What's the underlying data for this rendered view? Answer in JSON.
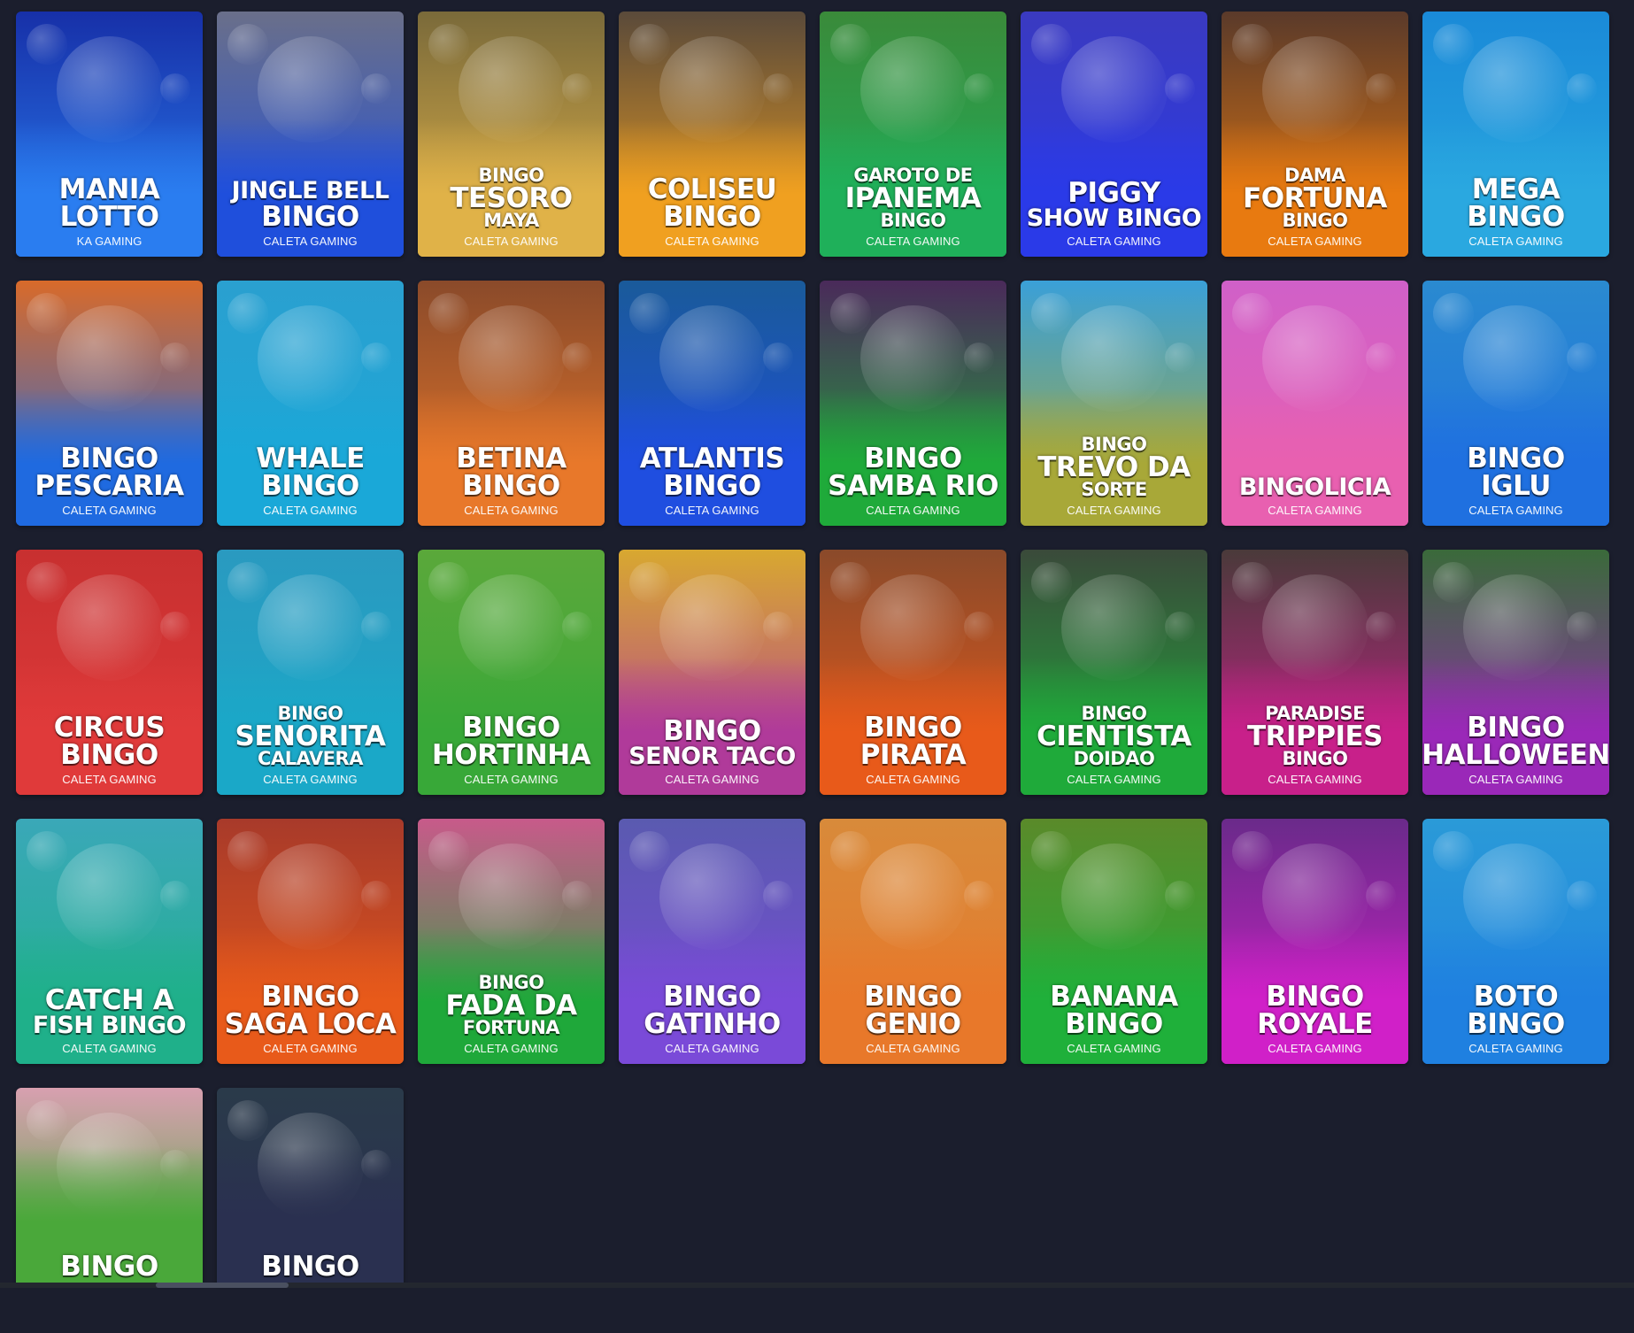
{
  "colors": {
    "page_background": "#1b1e2d",
    "title_text": "#ffffff"
  },
  "games": [
    {
      "title_lines": [
        "MANIA",
        "LOTTO"
      ],
      "provider": "KA GAMING",
      "theme": [
        "#1730a8",
        "#2a7df0"
      ],
      "icon": "lottery-ball-icon"
    },
    {
      "title_lines": [
        "JINGLE BELL",
        "BINGO"
      ],
      "provider": "CALETA GAMING",
      "theme": [
        "#6a6f8a",
        "#1f4fdc"
      ],
      "icon": "santa-icon"
    },
    {
      "title_lines": [
        "BINGO",
        "TESORO",
        "MAYA"
      ],
      "provider": "CALETA GAMING",
      "theme": [
        "#7a6a3a",
        "#e0b248"
      ],
      "icon": "maya-warrior-icon"
    },
    {
      "title_lines": [
        "COLISEU",
        "BINGO"
      ],
      "provider": "CALETA GAMING",
      "theme": [
        "#5a4a3a",
        "#f0a020"
      ],
      "icon": "gladiator-icon"
    },
    {
      "title_lines": [
        "GAROTO DE",
        "IPANEMA",
        "BINGO"
      ],
      "provider": "CALETA GAMING",
      "theme": [
        "#3a8a3a",
        "#1fb05a"
      ],
      "icon": "sailor-icon"
    },
    {
      "title_lines": [
        "PIGGY",
        "SHOW BINGO"
      ],
      "provider": "CALETA GAMING",
      "theme": [
        "#3a3ac0",
        "#2a3ae8"
      ],
      "icon": "pig-icon"
    },
    {
      "title_lines": [
        "DAMA",
        "FORTUNA",
        "BINGO"
      ],
      "provider": "CALETA GAMING",
      "theme": [
        "#5a3a2a",
        "#e87a10"
      ],
      "icon": "fortune-teller-icon"
    },
    {
      "title_lines": [
        "MEGA",
        "BINGO"
      ],
      "provider": "CALETA GAMING",
      "theme": [
        "#1a8ad8",
        "#2aa8e0"
      ],
      "icon": "bingo-ball-icon"
    },
    {
      "title_lines": [
        "BINGO",
        "PESCARIA"
      ],
      "provider": "CALETA GAMING",
      "theme": [
        "#d86a2a",
        "#1f6ae0"
      ],
      "icon": "fisherman-icon"
    },
    {
      "title_lines": [
        "WHALE",
        "BINGO"
      ],
      "provider": "CALETA GAMING",
      "theme": [
        "#2aa0d0",
        "#1aa8d8"
      ],
      "icon": "whale-icon"
    },
    {
      "title_lines": [
        "BETINA",
        "BINGO"
      ],
      "provider": "CALETA GAMING",
      "theme": [
        "#8a4a2a",
        "#e8782a"
      ],
      "icon": "woman-icon"
    },
    {
      "title_lines": [
        "ATLANTIS",
        "BINGO"
      ],
      "provider": "CALETA GAMING",
      "theme": [
        "#1a5a9a",
        "#1f4ee0"
      ],
      "icon": "poseidon-icon"
    },
    {
      "title_lines": [
        "BINGO",
        "SAMBA RIO"
      ],
      "provider": "CALETA GAMING",
      "theme": [
        "#4a2a5a",
        "#1faa3a"
      ],
      "icon": "samba-dancer-icon"
    },
    {
      "title_lines": [
        "BINGO",
        "TREVO DA",
        "SORTE"
      ],
      "provider": "CALETA GAMING",
      "theme": [
        "#3aa0d8",
        "#a8a838"
      ],
      "icon": "leprechaun-icon"
    },
    {
      "title_lines": [
        "BINGOLICIA"
      ],
      "provider": "CALETA GAMING",
      "theme": [
        "#d060c8",
        "#e860b0"
      ],
      "icon": "chef-icon"
    },
    {
      "title_lines": [
        "BINGO",
        "IGLU"
      ],
      "provider": "CALETA GAMING",
      "theme": [
        "#2a8ad0",
        "#1f70e0"
      ],
      "icon": "polar-bear-icon"
    },
    {
      "title_lines": [
        "CIRCUS",
        "BINGO"
      ],
      "provider": "CALETA GAMING",
      "theme": [
        "#c83030",
        "#e03a3a"
      ],
      "icon": "seal-icon"
    },
    {
      "title_lines": [
        "BINGO",
        "SENORITA",
        "CALAVERA"
      ],
      "provider": "CALETA GAMING",
      "theme": [
        "#2a9ac0",
        "#1aa8c8"
      ],
      "icon": "skeleton-icon"
    },
    {
      "title_lines": [
        "BINGO",
        "HORTINHA"
      ],
      "provider": "CALETA GAMING",
      "theme": [
        "#5aa83a",
        "#38a838"
      ],
      "icon": "carrot-icon"
    },
    {
      "title_lines": [
        "BINGO",
        "SENOR TACO"
      ],
      "provider": "CALETA GAMING",
      "theme": [
        "#d8a830",
        "#b03a9a"
      ],
      "icon": "sombrero-icon"
    },
    {
      "title_lines": [
        "BINGO",
        "PIRATA"
      ],
      "provider": "CALETA GAMING",
      "theme": [
        "#8a4a2a",
        "#e85a1a"
      ],
      "icon": "pirate-icon"
    },
    {
      "title_lines": [
        "BINGO",
        "CIENTISTA",
        "DOIDAO"
      ],
      "provider": "CALETA GAMING",
      "theme": [
        "#3a4a3a",
        "#1faa3a"
      ],
      "icon": "scientist-icon"
    },
    {
      "title_lines": [
        "PARADISE",
        "TRIPPIES",
        "BINGO"
      ],
      "provider": "CALETA GAMING",
      "theme": [
        "#4a3a3a",
        "#c8208a"
      ],
      "icon": "monkey-icon"
    },
    {
      "title_lines": [
        "BINGO",
        "HALLOWEEN"
      ],
      "provider": "CALETA GAMING",
      "theme": [
        "#3a6a3a",
        "#9a28b8"
      ],
      "icon": "witch-cauldron-icon"
    },
    {
      "title_lines": [
        "CATCH A",
        "FISH BINGO"
      ],
      "provider": "CALETA GAMING",
      "theme": [
        "#3aa8b8",
        "#1fb08a"
      ],
      "icon": "fish-icon"
    },
    {
      "title_lines": [
        "BINGO",
        "SAGA LOCA"
      ],
      "provider": "CALETA GAMING",
      "theme": [
        "#a83a2a",
        "#e85a1a"
      ],
      "icon": "bandit-icon"
    },
    {
      "title_lines": [
        "BINGO",
        "FADA DA",
        "FORTUNA"
      ],
      "provider": "CALETA GAMING",
      "theme": [
        "#c85a8a",
        "#1fa83a"
      ],
      "icon": "fairy-icon"
    },
    {
      "title_lines": [
        "BINGO",
        "GATINHO"
      ],
      "provider": "CALETA GAMING",
      "theme": [
        "#5a5ab0",
        "#7a4ad8"
      ],
      "icon": "cat-icon"
    },
    {
      "title_lines": [
        "BINGO",
        "GENIO"
      ],
      "provider": "CALETA GAMING",
      "theme": [
        "#d88a3a",
        "#e8782a"
      ],
      "icon": "genie-icon"
    },
    {
      "title_lines": [
        "BANANA",
        "BINGO"
      ],
      "provider": "CALETA GAMING",
      "theme": [
        "#5a8a2a",
        "#1fb03a"
      ],
      "icon": "monkey-icon"
    },
    {
      "title_lines": [
        "BINGO",
        "ROYALE"
      ],
      "provider": "CALETA GAMING",
      "theme": [
        "#6a2a8a",
        "#d020c8"
      ],
      "icon": "flapper-lady-icon"
    },
    {
      "title_lines": [
        "BOTO",
        "BINGO"
      ],
      "provider": "CALETA GAMING",
      "theme": [
        "#2a9ad8",
        "#1f80e0"
      ],
      "icon": "dolphin-icon"
    },
    {
      "title_lines": [
        "BINGO"
      ],
      "provider": "",
      "theme": [
        "#d8a0b0",
        "#4aa83a"
      ],
      "icon": "farmer-icon"
    },
    {
      "title_lines": [
        "BINGO"
      ],
      "provider": "",
      "theme": [
        "#2a3a4a",
        "#2a3050"
      ],
      "icon": "witch-icon"
    }
  ]
}
